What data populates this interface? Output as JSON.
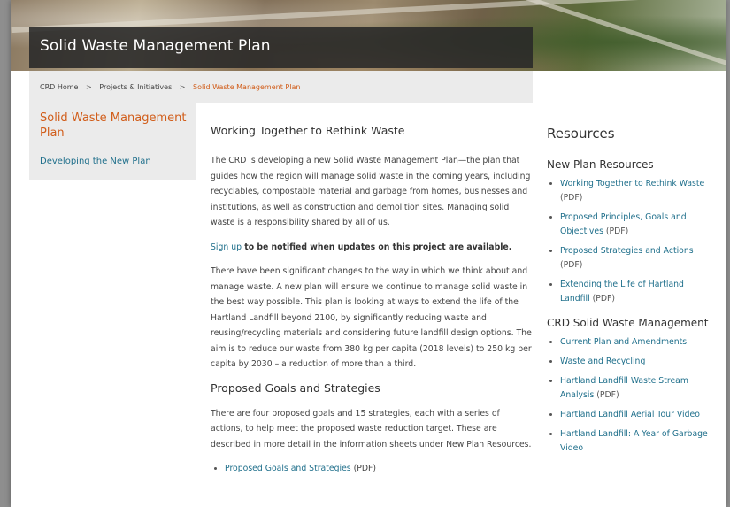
{
  "header": {
    "title": "Solid Waste Management Plan"
  },
  "breadcrumb": {
    "items": [
      "CRD Home",
      "Projects & Initiatives"
    ],
    "separator": ">",
    "current": "Solid Waste Management Plan"
  },
  "leftnav": {
    "title": "Solid Waste Management Plan",
    "items": [
      "Developing the New Plan"
    ]
  },
  "main": {
    "heading1": "Working Together to Rethink Waste",
    "para1": "The CRD is developing a new Solid Waste Management Plan—the plan that guides how the region will manage solid waste in the coming years, including recyclables, compostable material and garbage from homes, businesses and institutions, as well as construction and demolition sites. Managing solid waste is a responsibility shared by all of us.",
    "signup_link": "Sign up",
    "signup_rest": " to be notified when updates on this project are available.",
    "para2": "There have been significant changes to the way in which we think about and manage waste. A new plan will ensure we continue to manage solid waste in the best way possible. This plan is looking at ways to extend the life of the Hartland Landfill beyond 2100, by significantly reducing waste and reusing/recycling materials and considering future landfill design options. The aim is to reduce our waste from 380 kg per capita (2018 levels) to 250 kg per capita by 2030 – a reduction of more than a third.",
    "heading2": "Proposed Goals and Strategies",
    "para3": "There are four proposed goals and 15 strategies, each with a series of actions, to help meet the proposed waste reduction target. These are described in more detail in the information sheets under New Plan Resources.",
    "list": [
      {
        "label": "Proposed Goals and Strategies",
        "tag": " (PDF)"
      }
    ]
  },
  "resources": {
    "heading": "Resources",
    "section1": {
      "heading": "New Plan Resources",
      "items": [
        {
          "label": "Working Together to Rethink Waste",
          "tag": " (PDF)"
        },
        {
          "label": "Proposed Principles, Goals and Objectives",
          "tag": " (PDF)"
        },
        {
          "label": "Proposed Strategies and Actions",
          "tag": " (PDF)"
        },
        {
          "label": "Extending the Life of Hartland Landfill",
          "tag": " (PDF)"
        }
      ]
    },
    "section2": {
      "heading": "CRD Solid Waste Management",
      "items": [
        {
          "label": "Current Plan and Amendments",
          "tag": ""
        },
        {
          "label": "Waste and Recycling",
          "tag": ""
        },
        {
          "label": "Hartland Landfill Waste Stream Analysis",
          "tag": " (PDF)"
        },
        {
          "label": "Hartland Landfill Aerial Tour Video",
          "tag": ""
        },
        {
          "label": "Hartland Landfill: A Year of Garbage Video",
          "tag": ""
        }
      ]
    }
  },
  "colors": {
    "accent": "#d15d1a",
    "link": "#1f6f8b",
    "title_bar": "#282828",
    "panel": "#ebebeb"
  }
}
